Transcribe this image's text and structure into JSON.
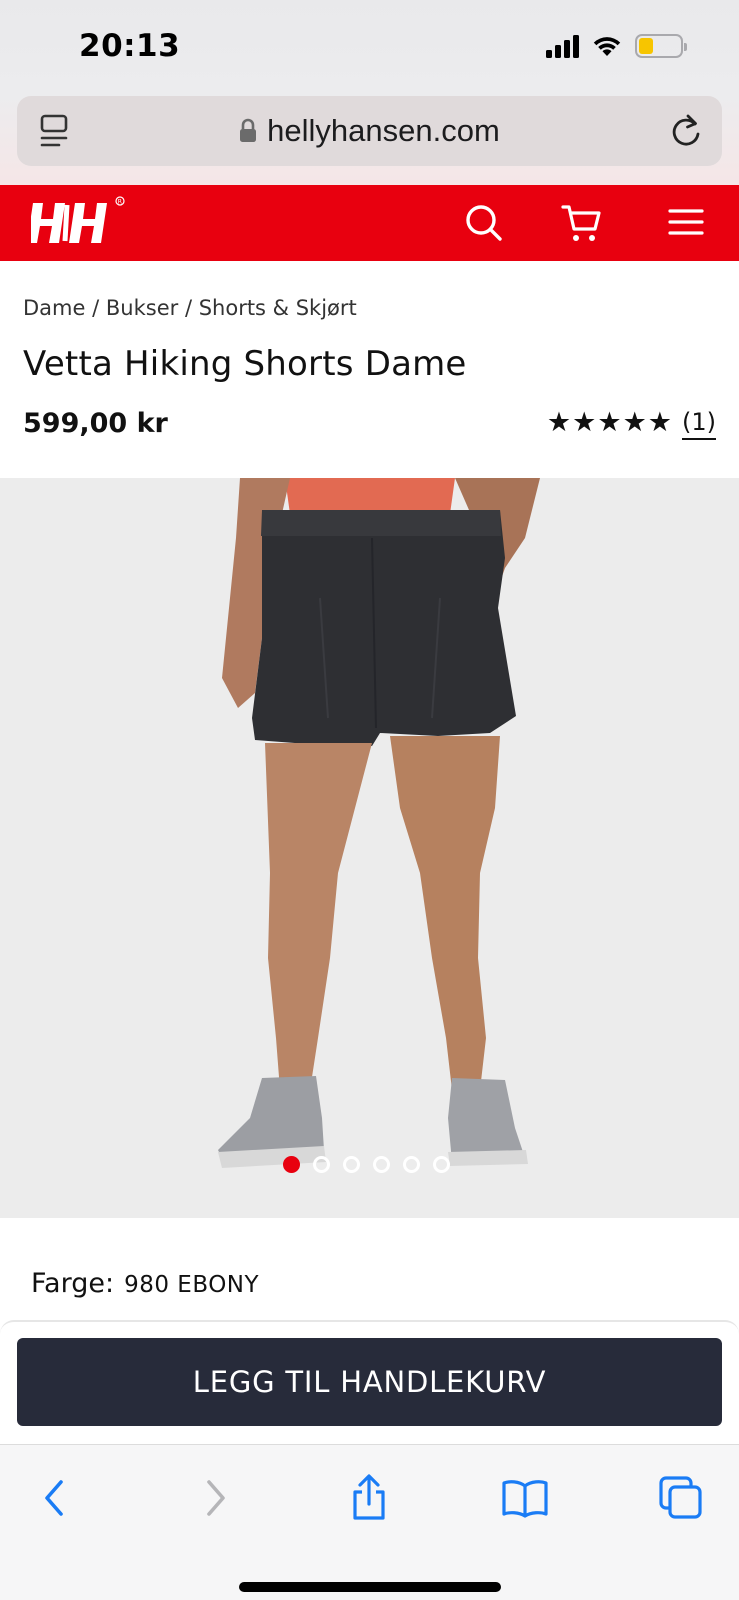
{
  "status_bar": {
    "time": "20:13",
    "icons": [
      "signal-icon",
      "wifi-icon",
      "battery-icon"
    ],
    "battery_level": 0.35,
    "battery_color": "#f7c500"
  },
  "browser": {
    "url": "hellyhansen.com",
    "icons": [
      "reader-icon",
      "lock-icon",
      "reload-icon"
    ]
  },
  "site_header": {
    "brand_color": "#e8000f",
    "logo": "HH",
    "icons": [
      "search-icon",
      "cart-icon",
      "menu-icon"
    ]
  },
  "breadcrumb": {
    "items": [
      "Dame",
      "Bukser",
      "Shorts & Skjørt"
    ],
    "separator": "/"
  },
  "product": {
    "title": "Vetta Hiking Shorts Dame",
    "price": "599,00 kr",
    "rating": 5,
    "rating_max": 5,
    "review_count": "(1)",
    "image_count": 6,
    "active_image": 1,
    "color_label": "Farge:",
    "color_value": "980 EBONY"
  },
  "cart": {
    "add_label": "LEGG TIL HANDLEKURV",
    "button_color": "#272b3a"
  },
  "safari_toolbar": {
    "icons": [
      "back-icon",
      "forward-icon",
      "share-icon",
      "bookmarks-icon",
      "tabs-icon"
    ],
    "accent": "#1a7cf5"
  }
}
